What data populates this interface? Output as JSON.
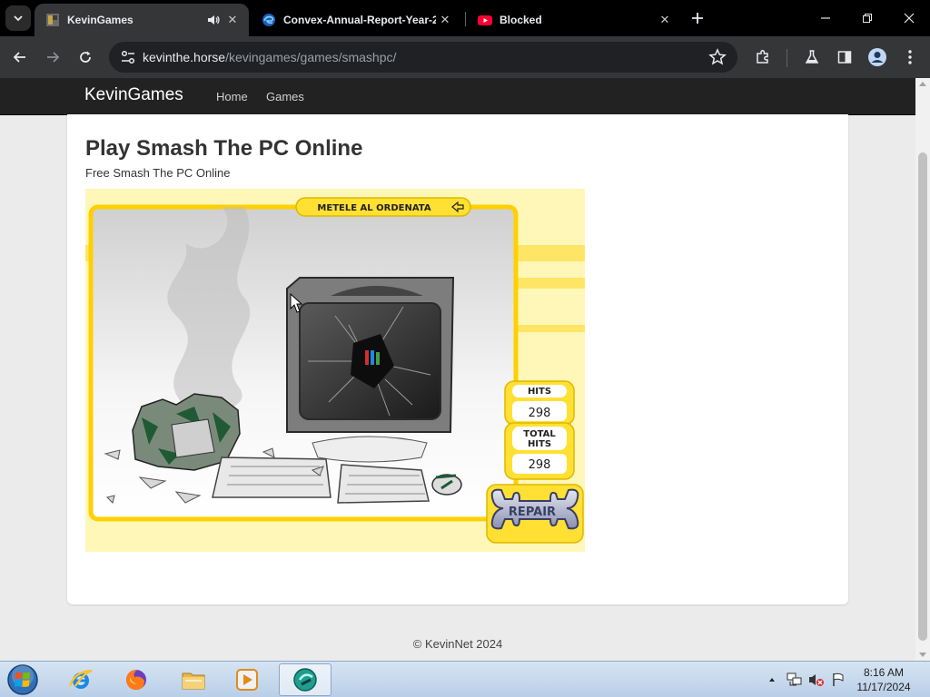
{
  "browser": {
    "tabs": [
      {
        "title": "KevinGames",
        "active": true,
        "audio": true
      },
      {
        "title": "Convex-Annual-Report-Year-2",
        "active": false
      },
      {
        "title": "Blocked",
        "active": false
      }
    ],
    "close_symbol": "✕",
    "address": {
      "host": "kevinthe.horse",
      "path": "/kevingames/games/smashpc/"
    }
  },
  "site": {
    "brand": "KevinGames",
    "nav": [
      "Home",
      "Games"
    ],
    "page_title": "Play Smash The PC Online",
    "page_subtitle": "Free Smash The PC Online",
    "footer": "© KevinNet 2024"
  },
  "game": {
    "banner": "METELE AL ORDENATA",
    "hits_label": "HITS",
    "hits_value": "298",
    "total_label_1": "TOTAL",
    "total_label_2": "HITS",
    "total_value": "298",
    "repair_label": "REPAIR"
  },
  "taskbar": {
    "time": "8:16 AM",
    "date": "11/17/2024"
  },
  "colors": {
    "game_yellow": "#ffe033",
    "game_bg": "#fff7b8",
    "navbar": "#222222"
  }
}
